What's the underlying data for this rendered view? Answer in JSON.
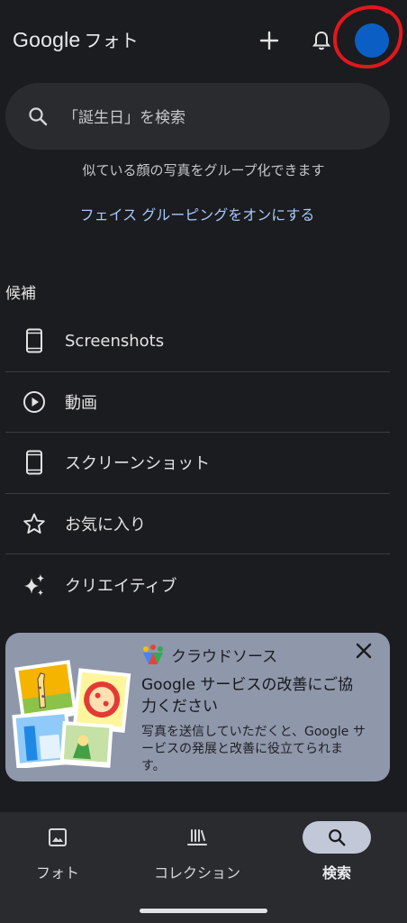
{
  "header": {
    "brand": "Google",
    "app_name": "フォト",
    "add_icon": "plus-icon",
    "notification_icon": "bell-icon",
    "avatar_color": "#0b5fc4",
    "annotation_color": "#e4161d"
  },
  "search": {
    "placeholder": "「誕生日」を検索",
    "icon": "search-icon"
  },
  "face_grouping": {
    "description": "似ている顔の写真をグループ化できます",
    "link": "フェイス グルーピングをオンにする"
  },
  "suggestions": {
    "title": "候補",
    "items": [
      {
        "label": "Screenshots",
        "icon": "phone-icon"
      },
      {
        "label": "動画",
        "icon": "play-circle-icon"
      },
      {
        "label": "スクリーンショット",
        "icon": "phone-icon"
      },
      {
        "label": "お気に入り",
        "icon": "star-icon"
      },
      {
        "label": "クリエイティブ",
        "icon": "sparkle-icon"
      }
    ]
  },
  "crowdsource_card": {
    "eyebrow": "クラウドソース",
    "title": "Google サービスの改善にご協力ください",
    "body": "写真を送信していただくと、Google サービスの発展と改善に役立てられます。",
    "close_icon": "close-icon",
    "background": "#8f97ab"
  },
  "bottom_nav": {
    "items": [
      {
        "label": "フォト",
        "icon": "photo-icon",
        "active": false
      },
      {
        "label": "コレクション",
        "icon": "library-icon",
        "active": false
      },
      {
        "label": "検索",
        "icon": "search-icon",
        "active": true
      }
    ]
  },
  "colors": {
    "background": "#1b1c1f",
    "surface": "#2a2b2f",
    "link": "#a8c7fa"
  }
}
